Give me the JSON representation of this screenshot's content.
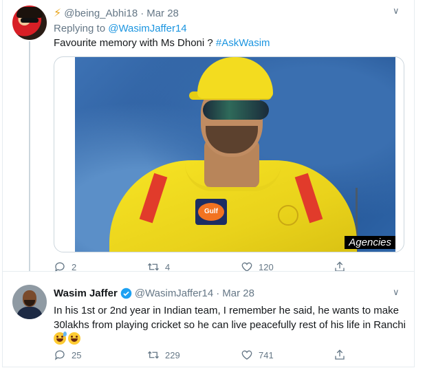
{
  "tweet1": {
    "username": "@being_Abhi18",
    "separator": "·",
    "date": "Mar 28",
    "replying_prefix": "Replying to",
    "replying_to": "@WasimJaffer14",
    "text": "Favourite memory with Ms Dhoni ? ",
    "hashtag": "#AskWasim",
    "media_credit": "Agencies",
    "jersey_sponsor": "Gulf",
    "replies": "2",
    "retweets": "4",
    "likes": "120"
  },
  "tweet2": {
    "display_name": "Wasim Jaffer",
    "username": "@WasimJaffer14",
    "separator": "·",
    "date": "Mar 28",
    "text": "In his 1st or 2nd year in Indian team, I remember he said, he wants to make 30lakhs from playing cricket so he can live peacefully rest of his life in Ranchi",
    "replies": "25",
    "retweets": "229",
    "likes": "741"
  },
  "icons": {
    "lightning": "lightning-icon",
    "chevron": "chevron-down-icon",
    "reply": "reply-icon",
    "retweet": "retweet-icon",
    "like": "heart-icon",
    "share": "share-icon",
    "verified": "verified-badge-icon"
  },
  "colors": {
    "link": "#1b95e0",
    "muted": "#657786",
    "verified": "#1da1f2"
  }
}
